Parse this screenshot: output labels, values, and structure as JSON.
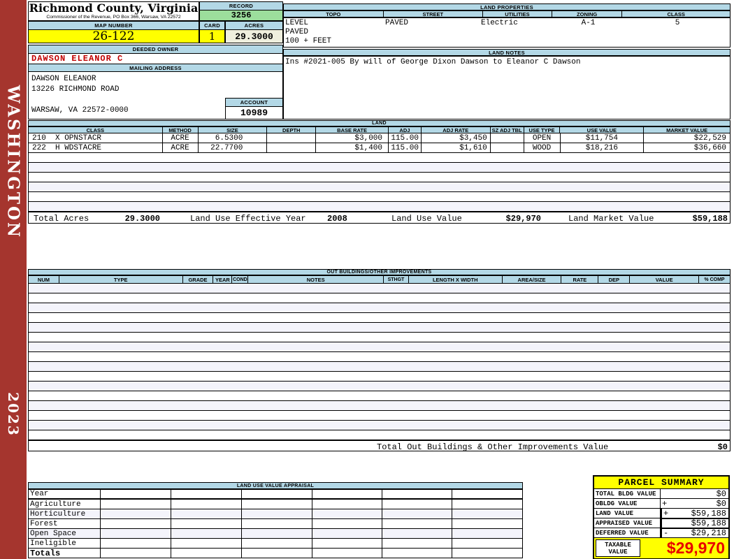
{
  "sidebar": {
    "district": "WASHINGTON",
    "year": "2023"
  },
  "header": {
    "county": "Richmond County, Virginia",
    "commissioner": "Commissioner of the Revenue, PO Box 366, Warsaw, VA 22572",
    "record_label": "RECORD",
    "record": "3256",
    "map_label": "MAP NUMBER",
    "map_number": "26-122",
    "card_label": "CARD",
    "card": "1",
    "acres_label": "ACRES",
    "acres": "29.3000"
  },
  "land_properties": {
    "title": "LAND PROPERTIES",
    "columns": [
      "TOPO",
      "STREET",
      "UTILITIES",
      "ZONING",
      "CLASS"
    ],
    "topo_line1": "LEVEL",
    "topo_line2": "PAVED",
    "topo_line3": "100 + FEET",
    "street": "PAVED",
    "utilities": "Electric",
    "zoning": "A-1",
    "class": "5"
  },
  "owner": {
    "deeded_label": "DEEDED OWNER",
    "name": "DAWSON ELEANOR C",
    "mailing_label": "MAILING ADDRESS",
    "address_line1": "DAWSON ELEANOR",
    "address_line2": "13226 RICHMOND ROAD",
    "address_line3": "",
    "address_line4": "WARSAW, VA 22572-0000",
    "account_label": "ACCOUNT",
    "account": "10989"
  },
  "land_notes": {
    "title": "LAND NOTES",
    "note": "Ins #2021-005 By will of George Dixon Dawson to Eleanor C Dawson"
  },
  "land": {
    "title": "LAND",
    "columns": [
      "CLASS",
      "METHOD",
      "SIZE",
      "DEPTH",
      "BASE RATE",
      "ADJ",
      "ADJ RATE",
      "SZ ADJ TBL",
      "USE TYPE",
      "USE VALUE",
      "MARKET VALUE"
    ],
    "rows": [
      {
        "class": "210  X OPNSTACR",
        "method": "ACRE",
        "size": "6.5300",
        "depth": "",
        "base_rate": "$3,000",
        "adj": "115.00",
        "adj_rate": "$3,450",
        "sz_adj_tbl": "",
        "use_type": "OPEN",
        "use_value": "$11,754",
        "market_value": "$22,529"
      },
      {
        "class": "222  H WDSTACRE",
        "method": "ACRE",
        "size": "22.7700",
        "depth": "",
        "base_rate": "$1,400",
        "adj": "115.00",
        "adj_rate": "$1,610",
        "sz_adj_tbl": "",
        "use_type": "WOOD",
        "use_value": "$18,216",
        "market_value": "$36,660"
      }
    ],
    "totals": {
      "total_acres_label": "Total Acres",
      "total_acres": "29.3000",
      "effective_year_label": "Land Use Effective Year",
      "effective_year": "2008",
      "use_value_label": "Land Use Value",
      "use_value": "$29,970",
      "market_value_label": "Land Market Value",
      "market_value": "$59,188"
    }
  },
  "out_buildings": {
    "title": "OUT BUILDINGS/OTHER IMPROVEMENTS",
    "columns": [
      "NUM",
      "TYPE",
      "GRADE",
      "YEAR",
      "COND",
      "NOTES",
      "STHGT",
      "LENGTH X WIDTH",
      "AREA/SIZE",
      "RATE",
      "DEP",
      "VALUE",
      "% COMP"
    ],
    "total_label": "Total Out Buildings & Other Improvements Value",
    "total_value": "$0"
  },
  "land_use_appraisal": {
    "title": "LAND USE VALUE APPRAISAL",
    "row_labels": [
      "Year",
      "Agriculture",
      "Horticulture",
      "Forest",
      "Open Space",
      "Ineligible",
      "Totals"
    ]
  },
  "parcel_summary": {
    "title": "PARCEL SUMMARY",
    "rows": [
      {
        "label": "TOTAL BLDG VALUE",
        "op": "",
        "value": "$0"
      },
      {
        "label": "OBLDG VALUE",
        "op": "+",
        "value": "$0"
      },
      {
        "label": "LAND VALUE",
        "op": "+",
        "value": "$59,188"
      },
      {
        "label": "APPRAISED VALUE",
        "op": "",
        "value": "$59,188"
      },
      {
        "label": "DEFERRED VALUE",
        "op": "-",
        "value": "$29,218"
      }
    ],
    "taxable_label": "TAXABLE VALUE",
    "taxable_value": "$29,970"
  },
  "colors": {
    "header_blue": "#B3D8E6",
    "record_green": "#9CDE9C",
    "highlight_yellow": "#FFFF00",
    "acres_cream": "#EFEFDE",
    "sidebar_red": "#A5352E",
    "owner_red": "#C00000",
    "taxable_red": "#E80000",
    "stripe_lavender": "#F4F4FB"
  }
}
